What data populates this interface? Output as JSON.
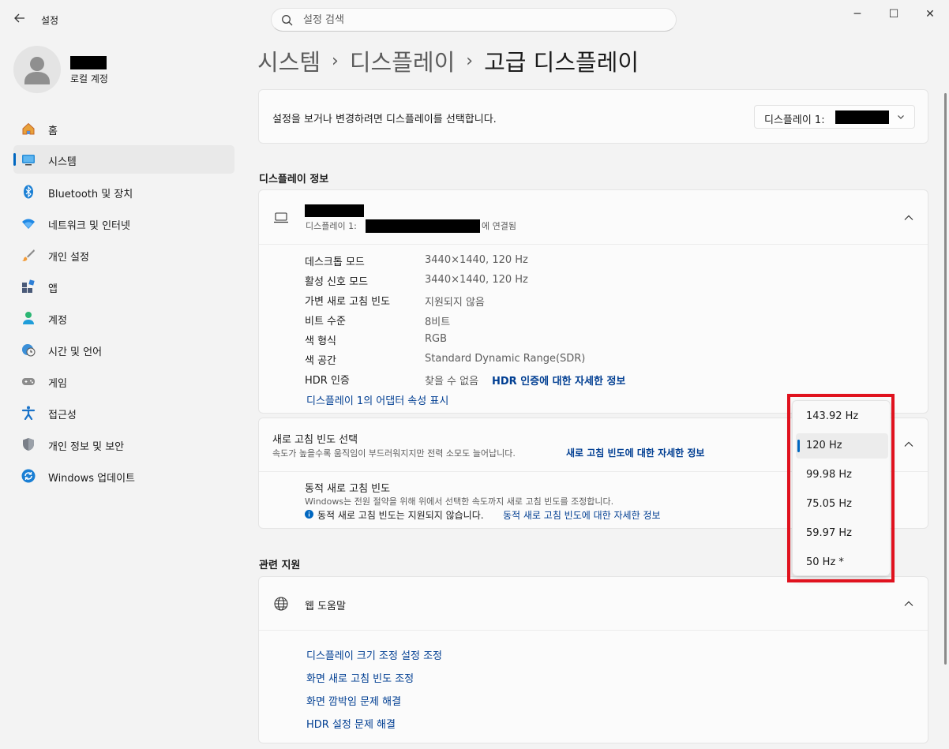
{
  "window": {
    "back_icon": "back-arrow-icon",
    "title": "설정",
    "controls": {
      "minimize": "─",
      "maximize": "☐",
      "close": "✕"
    }
  },
  "search": {
    "placeholder": "설정 검색",
    "value": ""
  },
  "account": {
    "type": "로컬 계정"
  },
  "nav": [
    {
      "label": "홈",
      "icon": "home-icon",
      "selected": false
    },
    {
      "label": "시스템",
      "icon": "system-icon",
      "selected": true
    },
    {
      "label": "Bluetooth 및 장치",
      "icon": "bluetooth-icon",
      "selected": false
    },
    {
      "label": "네트워크 및 인터넷",
      "icon": "wifi-icon",
      "selected": false
    },
    {
      "label": "개인 설정",
      "icon": "brush-icon",
      "selected": false
    },
    {
      "label": "앱",
      "icon": "apps-icon",
      "selected": false
    },
    {
      "label": "계정",
      "icon": "person-icon",
      "selected": false
    },
    {
      "label": "시간 및 언어",
      "icon": "globe-clock-icon",
      "selected": false
    },
    {
      "label": "게임",
      "icon": "gamepad-icon",
      "selected": false
    },
    {
      "label": "접근성",
      "icon": "accessibility-icon",
      "selected": false
    },
    {
      "label": "개인 정보 및 보안",
      "icon": "shield-icon",
      "selected": false
    },
    {
      "label": "Windows 업데이트",
      "icon": "update-icon",
      "selected": false
    }
  ],
  "breadcrumb": {
    "parts": [
      "시스템",
      "디스플레이"
    ],
    "current": "고급 디스플레이"
  },
  "select_display": {
    "text": "설정을 보거나 변경하려면 디스플레이를 선택합니다.",
    "dropdown_prefix": "디스플레이 1:"
  },
  "display_info": {
    "heading": "디스플레이 정보",
    "connection_prefix": "디스플레이 1:",
    "connection_suffix": "에 연결됨",
    "rows": [
      {
        "label": "데스크톱 모드",
        "value": "3440×1440, 120 Hz"
      },
      {
        "label": "활성 신호 모드",
        "value": "3440×1440, 120 Hz"
      },
      {
        "label": "가변 새로 고침 빈도",
        "value": "지원되지 않음"
      },
      {
        "label": "비트 수준",
        "value": "8비트"
      },
      {
        "label": "색 형식",
        "value": "RGB"
      },
      {
        "label": "색 공간",
        "value": "Standard Dynamic Range(SDR)"
      },
      {
        "label": "HDR 인증",
        "value": "찾을 수 없음",
        "link": "HDR 인증에 대한 자세한 정보"
      }
    ],
    "adapter_link": "디스플레이 1의 어댑터 속성 표시"
  },
  "refresh_rate": {
    "title": "새로 고침 빈도 선택",
    "desc": "속도가 높을수록 움직임이 부드러워지지만 전력 소모도 늘어납니다.",
    "link": "새로 고침 빈도에 대한 자세한 정보",
    "dynamic_title": "동적 새로 고침 빈도",
    "dynamic_desc": "Windows는 전원 절약을 위해 위에서 선택한 속도까지 새로 고침 빈도를 조정합니다.",
    "dynamic_info": "동적 새로 고침 빈도는 지원되지 않습니다.",
    "dynamic_link": "동적 새로 고침 빈도에 대한 자세한 정보",
    "options": [
      "143.92 Hz",
      "120 Hz",
      "99.98 Hz",
      "75.05 Hz",
      "59.97 Hz",
      "50 Hz *"
    ],
    "selected": "120 Hz"
  },
  "related": {
    "heading": "관련 지원",
    "web_help": "웹 도움말",
    "links": [
      "디스플레이 크기 조정 설정 조정",
      "화면 새로 고침 빈도 조정",
      "화면 깜박임 문제 해결",
      "HDR 설정 문제 해결"
    ]
  },
  "colors": {
    "accent": "#0067c0",
    "link": "#003e92",
    "highlight": "#e0121e"
  }
}
